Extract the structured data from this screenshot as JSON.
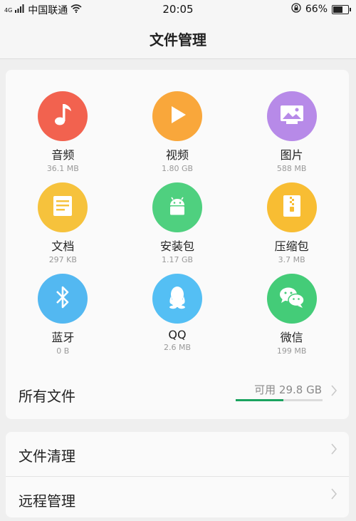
{
  "status_bar": {
    "network_badge": "4G",
    "carrier": "中国联通",
    "time": "20:05",
    "battery": "66%",
    "battery_level": 0.66
  },
  "header": {
    "title": "文件管理"
  },
  "categories": [
    {
      "label": "音频",
      "size": "36.1 MB",
      "icon": "music-note-icon",
      "color": "#f2624f"
    },
    {
      "label": "视频",
      "size": "1.80 GB",
      "icon": "play-icon",
      "color": "#f9a73b"
    },
    {
      "label": "图片",
      "size": "588 MB",
      "icon": "picture-icon",
      "color": "#b78ae8"
    },
    {
      "label": "文档",
      "size": "297 KB",
      "icon": "document-icon",
      "color": "#f6c23c"
    },
    {
      "label": "安装包",
      "size": "1.17 GB",
      "icon": "android-icon",
      "color": "#4fd07f"
    },
    {
      "label": "压缩包",
      "size": "3.7 MB",
      "icon": "zip-icon",
      "color": "#f8bd33"
    },
    {
      "label": "蓝牙",
      "size": "0 B",
      "icon": "bluetooth-icon",
      "color": "#53b8f1"
    },
    {
      "label": "QQ",
      "size": "2.6 MB",
      "icon": "qq-icon",
      "color": "#54bff4"
    },
    {
      "label": "微信",
      "size": "199 MB",
      "icon": "wechat-icon",
      "color": "#44cc78"
    }
  ],
  "all_files": {
    "label": "所有文件",
    "available": "可用 29.8 GB",
    "used_fraction": 0.55
  },
  "menu": {
    "clean": "文件清理",
    "remote": "远程管理"
  }
}
